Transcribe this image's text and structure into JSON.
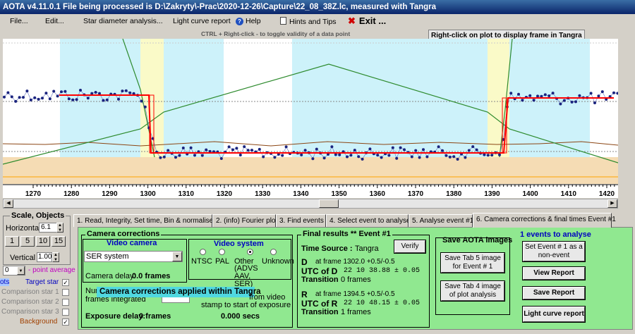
{
  "window": {
    "title": "AOTA v4.11.0.1    File being processed is D:\\Zakryty\\-Prac\\2020-12-26\\Capture\\22_08_38Z.lc, measured with Tangra"
  },
  "menu": {
    "file": "File...",
    "edit": "Edit...",
    "star_diameter": "Star diameter analysis...",
    "light_curve_report": "Light curve report",
    "help": "Help",
    "hints": "Hints and Tips",
    "exit": "Exit ..."
  },
  "notes": {
    "right_click": "Right-click on plot to display frame in Tangra",
    "ctrl_right_click": "CTRL + Right-click  -  to toggle validity of a data point"
  },
  "plot": {
    "x_ticks": [
      "1270",
      "1280",
      "1290",
      "1300",
      "1310",
      "1320",
      "1330",
      "1340",
      "1350",
      "1360",
      "1370",
      "1380",
      "1390",
      "1400",
      "1410",
      "1420"
    ]
  },
  "colors": {
    "plot_bg": "#ffffff",
    "cyan_band": "#cdf2fa",
    "yellow_band": "#fafac8",
    "tan_band": "#f5dcb4",
    "data": "#1a237e",
    "fit": "#ff0000",
    "model": "#2e8b2e",
    "accent_green": "#90e890"
  },
  "left": {
    "scale_title": "Scale, Objects",
    "horizontal_label": "Horizontal",
    "horizontal_value": "6.1",
    "buttons": [
      "1",
      "5",
      "10",
      "15"
    ],
    "vertical_label": "Vertical",
    "vertical_value": "1.00",
    "point_avg_value": "0",
    "point_avg_label": "- point average",
    "target_star": "Target star",
    "target_prefix": "ots",
    "comparison1": "Comparison star 1",
    "comparison2": "Comparison star 2",
    "comparison3": "Comparison star 3",
    "background": "Background"
  },
  "tabs": [
    "1.  Read, Integrity, Set time, Bin & normalise",
    "2. (info)  Fourier plot",
    "3. Find events",
    "4. Select event to analyse",
    "5. Analyse event #1",
    "6. Camera corrections & final times Event #1"
  ],
  "camera": {
    "title": "Camera corrections",
    "video_camera": "Video camera",
    "camera_select": "SER system",
    "camera_delay_label": "Camera delay:",
    "camera_delay_value": "0.0 frames",
    "video_system": "Video system",
    "radios": [
      "NTSC",
      "PAL",
      "Other",
      "Unknown"
    ],
    "other_detail": "(ADVS AAV, SER)",
    "num_frames_label_1": "Num",
    "num_frames_label_2": "frames integrated",
    "applied_banner": "Camera corrections applied within Tangra",
    "from_video": "from video",
    "stamp_text": "stamp to start of exposure",
    "offset_value": "0.000 secs",
    "exposure_delay_label": "Exposure delay:",
    "exposure_delay_value": "0 frames"
  },
  "results": {
    "title": "Final results  ** Event #1",
    "time_source_label": "Time Source :",
    "time_source_value": "Tangra",
    "verify": "Verify",
    "d_label": "D",
    "d_frame": "at frame 1302.0  +0.5/-0.5",
    "utc_d_label": "UTC of D",
    "utc_d_value": "22 10 38.88  ± 0.05",
    "transition_label": "Transition",
    "transition_d": "0 frames",
    "r_label": "R",
    "r_frame": "at frame 1394.5  +0.5/-0.5",
    "utc_r_label": "UTC of R",
    "utc_r_value": "22 10 48.15  ± 0.05",
    "transition_r": "1 frames"
  },
  "save": {
    "title": "Save AOTA images",
    "tab5": "Save Tab 5 image for Event # 1",
    "tab4": "Save Tab 4 image of plot analysis"
  },
  "report": {
    "count": "1  events to analyse",
    "set_event": "Set Event # 1 as a non-event",
    "view": "View Report",
    "save": "Save Report",
    "lc": "Light curve report"
  }
}
